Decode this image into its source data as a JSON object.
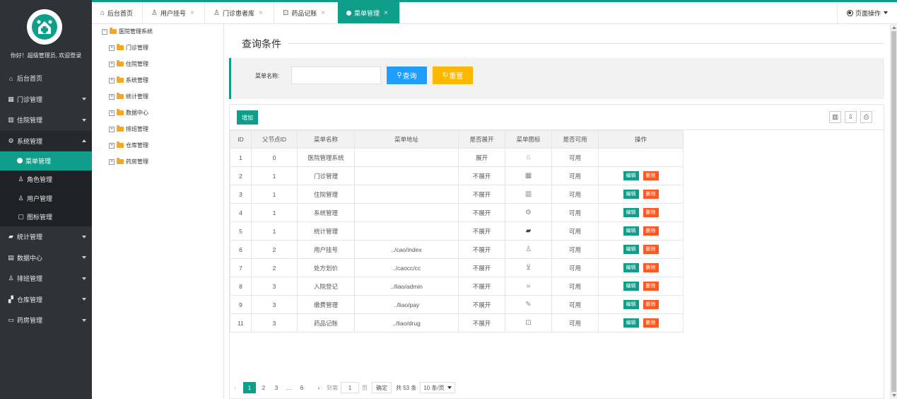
{
  "sidebar": {
    "welcome": "你好！超级管理员, 欢迎登录",
    "colors": {
      "bg": "#2f3338",
      "active": "#0f9e8a"
    },
    "items": [
      {
        "label": "后台首页",
        "icon": "home-icon"
      },
      {
        "label": "门诊管理",
        "icon": "grid-icon"
      },
      {
        "label": "住院管理",
        "icon": "building-icon"
      },
      {
        "label": "系统管理",
        "icon": "gear-icon"
      },
      {
        "label": "统计管理",
        "icon": "chat-icon"
      },
      {
        "label": "数据中心",
        "icon": "document-icon"
      },
      {
        "label": "排班管理",
        "icon": "user-icon"
      },
      {
        "label": "仓库管理",
        "icon": "boxes-icon"
      },
      {
        "label": "药房管理",
        "icon": "book-icon"
      }
    ],
    "sub_items": [
      {
        "label": "菜单管理",
        "icon": "dot-icon"
      },
      {
        "label": "角色管理",
        "icon": "user-icon"
      },
      {
        "label": "用户管理",
        "icon": "user-icon"
      },
      {
        "label": "图标管理",
        "icon": "file-icon"
      }
    ]
  },
  "tabs": [
    {
      "label": "后台首页",
      "icon": "home-icon"
    },
    {
      "label": "用户挂号",
      "icon": "user-icon"
    },
    {
      "label": "门诊患者库",
      "icon": "user-icon"
    },
    {
      "label": "药品记账",
      "icon": "book-icon"
    },
    {
      "label": "菜单管理",
      "icon": "dot-icon"
    }
  ],
  "page_ops": "页面操作",
  "tree": {
    "root": "医院管理系统",
    "children": [
      "门诊管理",
      "住院管理",
      "系统管理",
      "统计管理",
      "数据中心",
      "排班管理",
      "仓库管理",
      "药房管理"
    ]
  },
  "query": {
    "title": "查询条件",
    "label": "菜单名称:",
    "input_value": "",
    "search": "查询",
    "reset": "重置"
  },
  "toolbar": {
    "add": "增加"
  },
  "table": {
    "headers": [
      "ID",
      "父节点ID",
      "菜单名称",
      "菜单地址",
      "是否展开",
      "菜单图标",
      "是否可用",
      "操作"
    ],
    "edit_label": "编辑",
    "delete_label": "删除",
    "rows": [
      {
        "id": "1",
        "pid": "0",
        "name": "医院管理系统",
        "url": "",
        "open": "展开",
        "icon": "home-icon",
        "usable": "可用",
        "ops": false
      },
      {
        "id": "2",
        "pid": "1",
        "name": "门诊管理",
        "url": "",
        "open": "不展开",
        "icon": "grid-icon",
        "usable": "可用",
        "ops": true
      },
      {
        "id": "3",
        "pid": "1",
        "name": "住院管理",
        "url": "",
        "open": "不展开",
        "icon": "building-icon",
        "usable": "可用",
        "ops": true
      },
      {
        "id": "4",
        "pid": "1",
        "name": "系统管理",
        "url": "",
        "open": "不展开",
        "icon": "gear-icon",
        "usable": "可用",
        "ops": true
      },
      {
        "id": "5",
        "pid": "1",
        "name": "统计管理",
        "url": "",
        "open": "不展开",
        "icon": "chat-icon",
        "usable": "可用",
        "ops": true
      },
      {
        "id": "6",
        "pid": "2",
        "name": "用户挂号",
        "url": "../cao/index",
        "open": "不展开",
        "icon": "user-icon",
        "usable": "可用",
        "ops": true
      },
      {
        "id": "7",
        "pid": "2",
        "name": "处方划价",
        "url": "../caocc/cc",
        "open": "不展开",
        "icon": "cart-icon",
        "usable": "可用",
        "ops": true
      },
      {
        "id": "8",
        "pid": "3",
        "name": "入院登记",
        "url": "../liao/admin",
        "open": "不展开",
        "icon": "double-chevron-icon",
        "usable": "可用",
        "ops": true
      },
      {
        "id": "9",
        "pid": "3",
        "name": "缴费管理",
        "url": "../liao/pay",
        "open": "不展开",
        "icon": "edit-icon",
        "usable": "可用",
        "ops": true
      },
      {
        "id": "11",
        "pid": "3",
        "name": "药品记账",
        "url": "../liao/drug",
        "open": "不展开",
        "icon": "book-icon",
        "usable": "可用",
        "ops": true
      }
    ]
  },
  "pager": {
    "pages": [
      "1",
      "2",
      "3",
      "…",
      "6"
    ],
    "goto_label": "到第",
    "goto_value": "1",
    "page_unit": "页",
    "confirm": "确定",
    "total": "共 53 条",
    "per_page": "10 条/页"
  }
}
